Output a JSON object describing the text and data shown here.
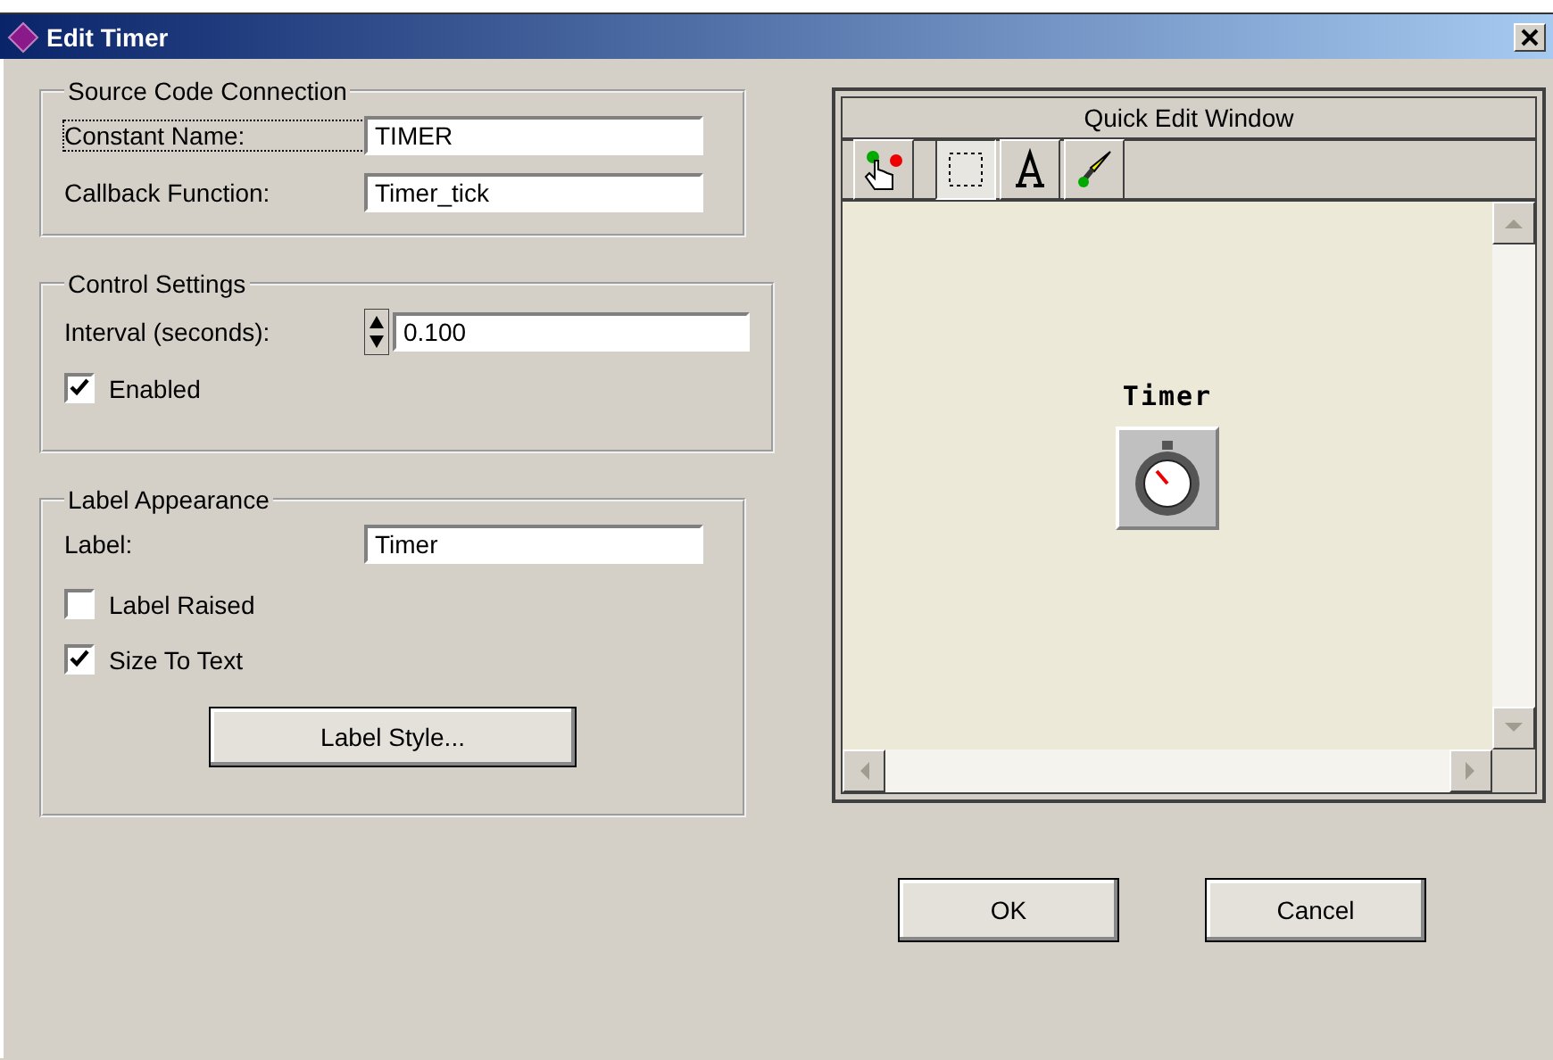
{
  "window": {
    "title": "Edit Timer"
  },
  "source_code_connection": {
    "title": "Source Code Connection",
    "fields": [
      {
        "label": "Constant Name:",
        "value": "TIMER",
        "focused": true
      },
      {
        "label": "Callback Function:",
        "value": "Timer_tick",
        "focused": false
      }
    ]
  },
  "control_settings": {
    "title": "Control Settings",
    "interval": {
      "label": "Interval (seconds):",
      "value": "0.100"
    },
    "checkboxes": [
      {
        "label": "Enabled",
        "checked": true
      }
    ]
  },
  "label_appearance": {
    "title": "Label Appearance",
    "label_field": {
      "label": "Label:",
      "value": "Timer"
    },
    "checkboxes": [
      {
        "label": "Label Raised",
        "checked": false
      },
      {
        "label": "Size To Text",
        "checked": true
      }
    ],
    "button": "Label Style..."
  },
  "quick_edit": {
    "title": "Quick Edit Window",
    "tools": [
      {
        "kind": "operate",
        "selected": false
      },
      {
        "kind": "select",
        "selected": true
      },
      {
        "kind": "text",
        "selected": false
      },
      {
        "kind": "color",
        "selected": false
      }
    ],
    "control_label": "Timer"
  },
  "buttons": [
    "OK",
    "Cancel"
  ]
}
